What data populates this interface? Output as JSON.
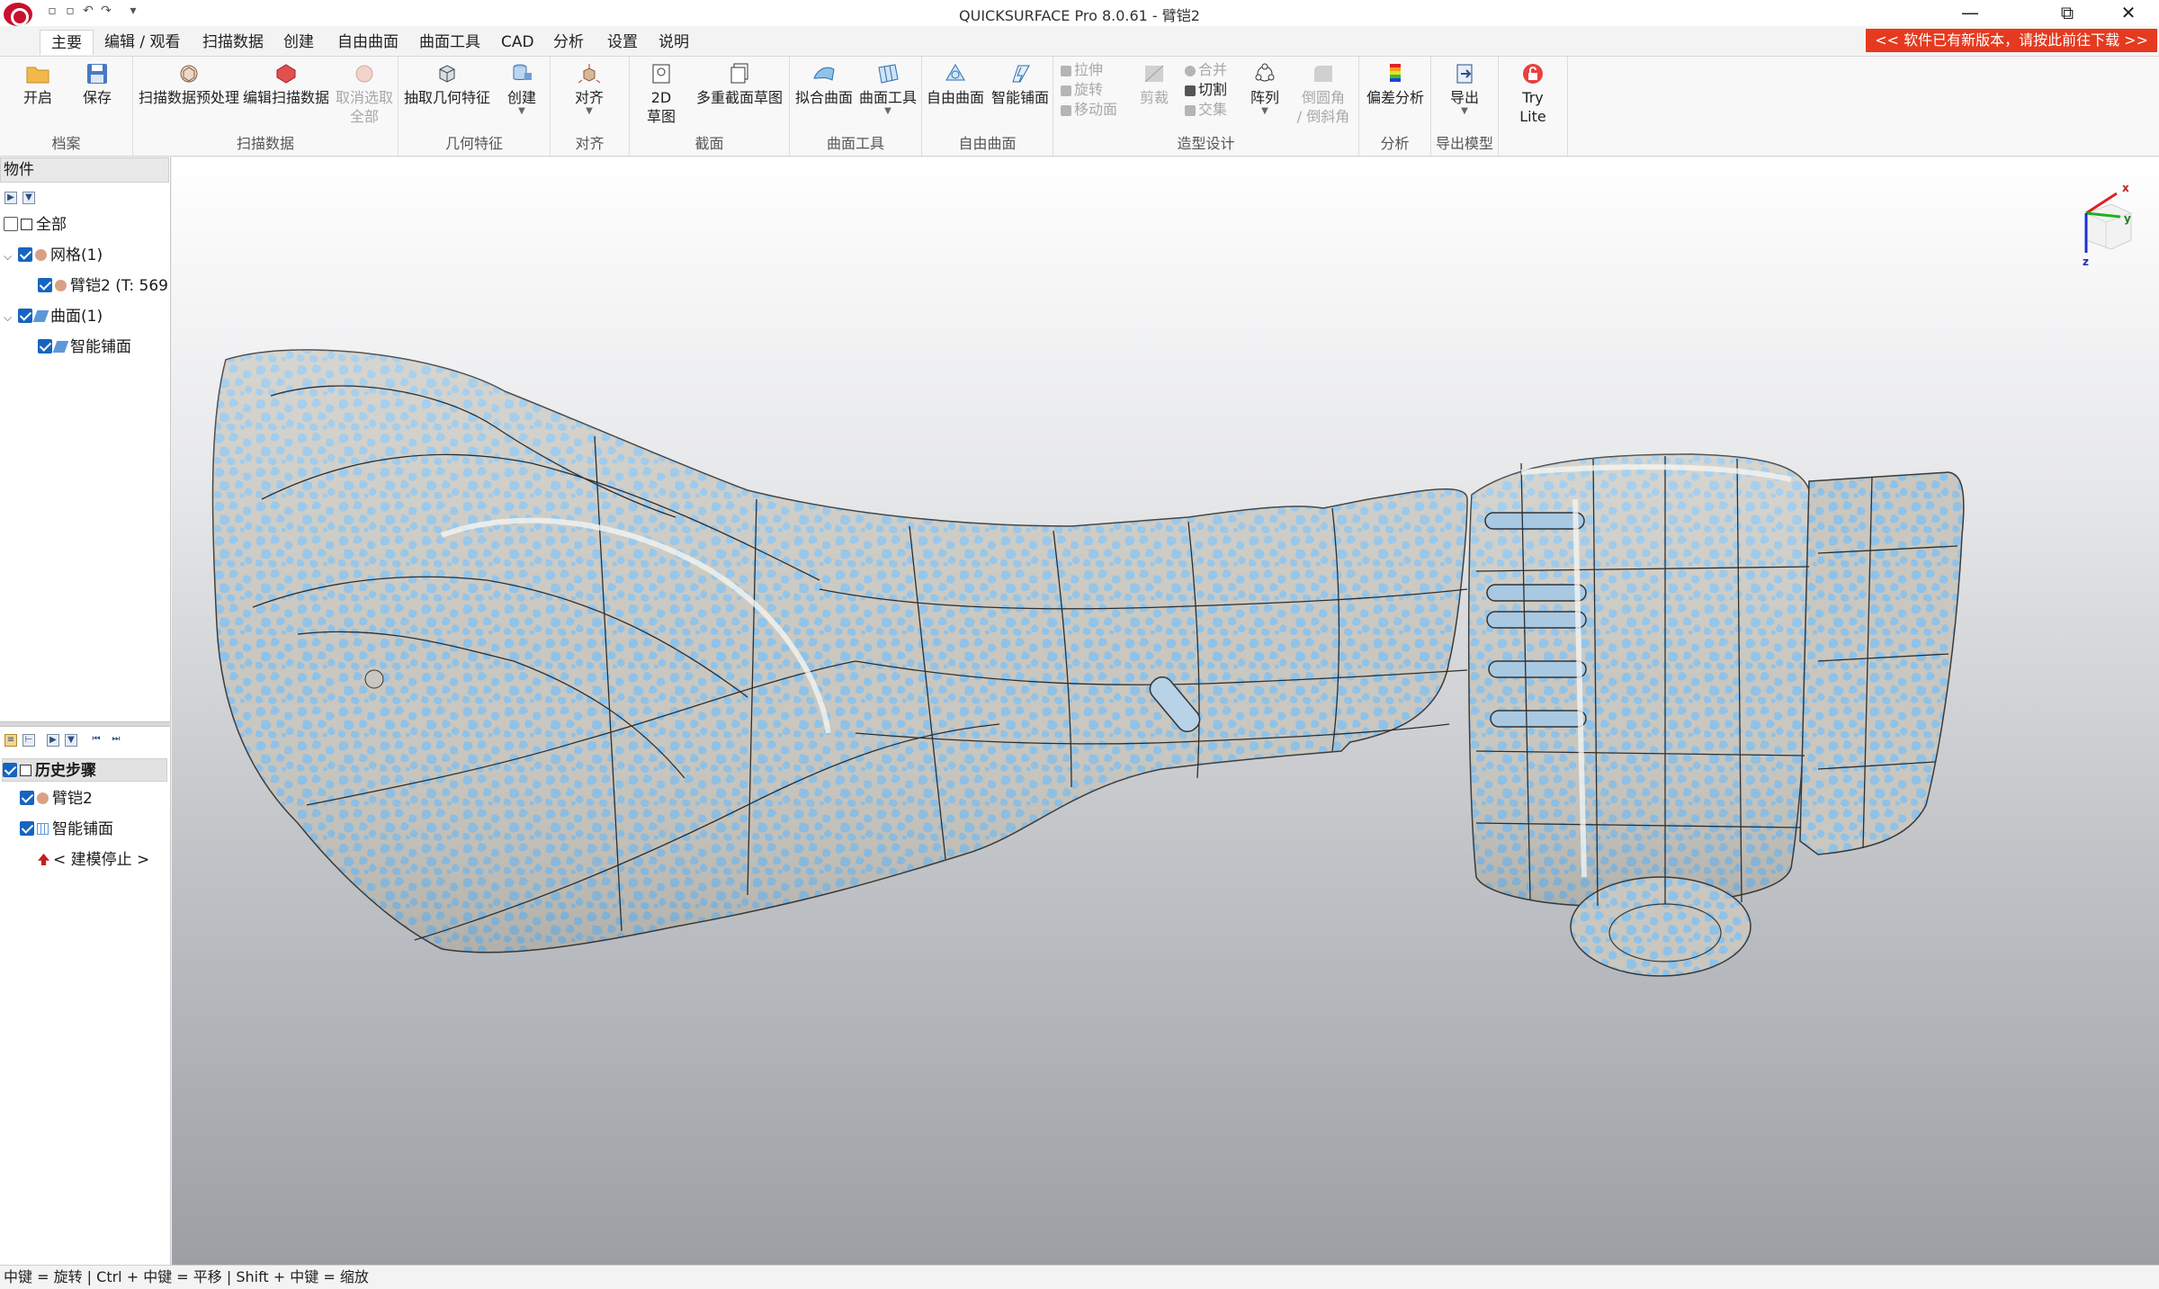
{
  "window": {
    "title": "QUICKSURFACE Pro 8.0.61 - 臂铠2",
    "controls": {
      "minimize": "—",
      "restore": "⧉",
      "close": "✕"
    }
  },
  "menu": {
    "tabs": [
      "主要",
      "编辑 / 观看",
      "扫描数据",
      "创建",
      "自由曲面",
      "曲面工具",
      "CAD",
      "分析",
      "设置",
      "说明"
    ],
    "active_tab": "主要",
    "update_banner": "<< 软件已有新版本，请按此前往下载 >>"
  },
  "ribbon": {
    "file": {
      "label": "档案",
      "open": "开启",
      "save": "保存"
    },
    "scan": {
      "label": "扫描数据",
      "preprocess": "扫描数据预处理",
      "edit": "编辑扫描数据",
      "deselect_1": "取消选取",
      "deselect_2": "全部"
    },
    "geom": {
      "label": "几何特征",
      "extract": "抽取几何特征",
      "create": "创建"
    },
    "align": {
      "label": "对齐",
      "align": "对齐"
    },
    "section": {
      "label": "截面",
      "sketch2d_1": "2D",
      "sketch2d_2": "草图",
      "multi": "多重截面草图"
    },
    "surftools": {
      "label": "曲面工具",
      "fit": "拟合曲面",
      "tools": "曲面工具"
    },
    "freeform": {
      "label": "自由曲面",
      "free": "自由曲面",
      "smart": "智能铺面"
    },
    "modeling": {
      "label": "造型设计",
      "extrude": "拉伸",
      "revolve": "旋转",
      "move_face": "移动面",
      "trim": "剪裁",
      "union": "合并",
      "cut": "切割",
      "intersect": "交集",
      "pattern": "阵列",
      "fillet_1": "倒圆角",
      "fillet_2": "/ 倒斜角"
    },
    "analysis": {
      "label": "分析",
      "deviation": "偏差分析"
    },
    "export": {
      "label": "导出模型",
      "export": "导出",
      "try_1": "Try",
      "try_2": "Lite"
    }
  },
  "objects_panel": {
    "header": "物件",
    "all": "全部",
    "mesh_group": "网格(1)",
    "mesh_item": "臂铠2 (T: 569",
    "surface_group": "曲面(1)",
    "surface_item": "智能铺面"
  },
  "history_panel": {
    "header": "历史步骤",
    "items": [
      "臂铠2",
      "智能铺面"
    ],
    "stop": "< 建模停止 >"
  },
  "viewport": {
    "axes": {
      "x": "x",
      "y": "y",
      "z": "z"
    },
    "colors": {
      "mesh_blue": "#8fc2e8",
      "mesh_grey": "#c9c7c0",
      "x_axis": "#e02020",
      "y_axis": "#20b020",
      "z_axis": "#2030d0"
    }
  },
  "statusbar": {
    "hint": "中键 = 旋转 | Ctrl + 中键 = 平移 | Shift + 中键 = 缩放"
  }
}
